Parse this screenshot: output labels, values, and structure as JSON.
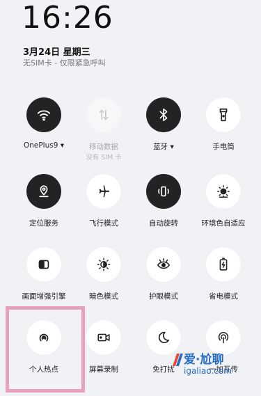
{
  "status": {
    "time": "16:26",
    "date": "3月24日  星期三",
    "carrier": "无SIM卡 - 仅限紧急呼叫"
  },
  "tiles": [
    {
      "label": "OnePlus9 ▾",
      "icon": "wifi-icon",
      "state": "on"
    },
    {
      "label": "移动数据",
      "sublabel": "没有 SIM 卡",
      "icon": "mobile-data-icon",
      "state": "disabled"
    },
    {
      "label": "蓝牙 ▾",
      "icon": "bluetooth-icon",
      "state": "on"
    },
    {
      "label": "手电筒",
      "icon": "flashlight-icon",
      "state": "off"
    },
    {
      "label": "定位服务",
      "icon": "location-icon",
      "state": "on"
    },
    {
      "label": "飞行模式",
      "icon": "airplane-icon",
      "state": "off"
    },
    {
      "label": "自动旋转",
      "icon": "auto-rotate-icon",
      "state": "on"
    },
    {
      "label": "环境色自适应",
      "icon": "ambient-color-icon",
      "state": "off"
    },
    {
      "label": "画面增强引擎",
      "icon": "display-enhance-icon",
      "state": "off"
    },
    {
      "label": "暗色模式",
      "icon": "dark-mode-icon",
      "state": "off"
    },
    {
      "label": "护眼模式",
      "icon": "eye-care-icon",
      "state": "off"
    },
    {
      "label": "省电模式",
      "icon": "battery-saver-icon",
      "state": "off"
    },
    {
      "label": "个人热点",
      "icon": "hotspot-icon",
      "state": "off"
    },
    {
      "label": "屏幕录制",
      "icon": "screen-record-icon",
      "state": "off"
    },
    {
      "label": "免打扰",
      "icon": "do-not-disturb-icon",
      "state": "off"
    },
    {
      "label": "一加互传",
      "icon": "oneplus-share-icon",
      "state": "off"
    }
  ],
  "watermark": {
    "main": "爱·尬聊",
    "sub": "igaliao.com"
  },
  "colors": {
    "background": "#f1f2f5",
    "tile_on": "#222325",
    "tile_off": "#ffffff",
    "highlight": "#e8a0bf",
    "watermark": "#2a6ec4"
  }
}
